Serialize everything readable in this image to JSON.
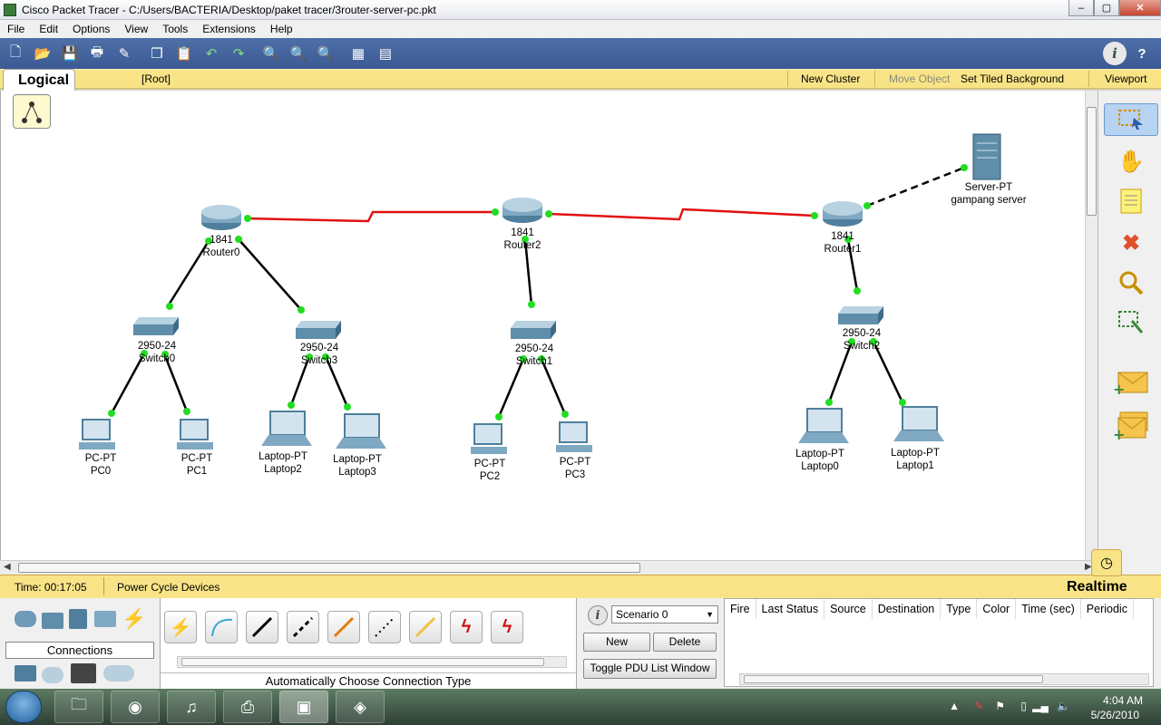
{
  "window": {
    "title": "Cisco Packet Tracer - C:/Users/BACTERIA/Desktop/paket tracer/3router-server-pc.pkt",
    "minimize": "–",
    "maximize": "▢",
    "close": "✕"
  },
  "menu": [
    "File",
    "Edit",
    "Options",
    "View",
    "Tools",
    "Extensions",
    "Help"
  ],
  "toolbar": {
    "icons": [
      "new-file-icon",
      "open-folder-icon",
      "save-icon",
      "print-icon",
      "activity-wizard-icon",
      "copy-icon",
      "paste-icon",
      "undo-icon",
      "redo-icon",
      "zoom-in-icon",
      "zoom-reset-icon",
      "zoom-out-icon",
      "drawing-palette-icon",
      "custom-device-icon"
    ],
    "info": "i",
    "help": "?"
  },
  "workspace_bar": {
    "tab": "Logical",
    "root": "[Root]",
    "new_cluster": "New Cluster",
    "move_object": "Move Object",
    "set_tiled_background": "Set Tiled Background",
    "viewport": "Viewport"
  },
  "devices": {
    "router0": {
      "model": "1841",
      "name": "Router0"
    },
    "router2": {
      "model": "1841",
      "name": "Router2"
    },
    "router1": {
      "model": "1841",
      "name": "Router1"
    },
    "switch0": {
      "model": "2950-24",
      "name": "Switch0"
    },
    "switch3": {
      "model": "2950-24",
      "name": "Switch3"
    },
    "switch1": {
      "model": "2950-24",
      "name": "Switch1"
    },
    "switch2": {
      "model": "2950-24",
      "name": "Switch2"
    },
    "server": {
      "model": "Server-PT",
      "name": "gampang server"
    },
    "pc0": {
      "model": "PC-PT",
      "name": "PC0"
    },
    "pc1": {
      "model": "PC-PT",
      "name": "PC1"
    },
    "pc2": {
      "model": "PC-PT",
      "name": "PC2"
    },
    "pc3": {
      "model": "PC-PT",
      "name": "PC3"
    },
    "laptop0": {
      "model": "Laptop-PT",
      "name": "Laptop0"
    },
    "laptop1": {
      "model": "Laptop-PT",
      "name": "Laptop1"
    },
    "laptop2": {
      "model": "Laptop-PT",
      "name": "Laptop2"
    },
    "laptop3": {
      "model": "Laptop-PT",
      "name": "Laptop3"
    }
  },
  "colors": {
    "serial_link": "#e21010",
    "ethernet_link": "#000000",
    "link_up": "#22dd22",
    "workspace_bar": "#f8e487",
    "toolbar": "#3f5f98"
  },
  "right_tools": [
    "select-icon",
    "move-layout-icon",
    "place-note-icon",
    "delete-icon",
    "inspect-icon",
    "resize-shape-icon",
    "add-simple-pdu-icon",
    "add-complex-pdu-icon"
  ],
  "status": {
    "time": "Time: 00:17:05",
    "power_cycle": "Power Cycle Devices",
    "mode": "Realtime"
  },
  "bottom": {
    "connections_label": "Connections",
    "auto_connection": "Automatically Choose Connection Type",
    "connection_types": [
      "automatic-connection-icon",
      "console-cable-icon",
      "copper-straight-through-icon",
      "copper-cross-over-icon",
      "fiber-icon",
      "phone-cable-icon",
      "coaxial-cable-icon",
      "serial-dce-icon",
      "serial-dte-icon"
    ],
    "scenario": "Scenario 0",
    "new_btn": "New",
    "delete_btn": "Delete",
    "toggle_pdu": "Toggle PDU List Window",
    "pdu_columns": [
      "Fire",
      "Last Status",
      "Source",
      "Destination",
      "Type",
      "Color",
      "Time (sec)",
      "Periodic"
    ]
  },
  "taskbar": {
    "time": "4:04 AM",
    "date": "5/26/2010",
    "apps": [
      "explorer-icon",
      "firefox-icon",
      "itunes-icon",
      "acrobat-icon",
      "packet-tracer-icon",
      "unity-icon"
    ]
  }
}
